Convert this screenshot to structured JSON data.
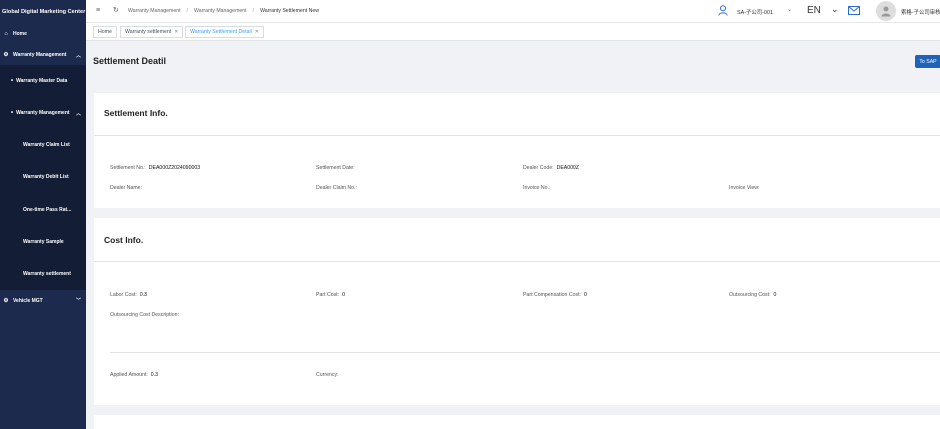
{
  "sidebar": {
    "title": "Global Digital Marketing Center",
    "home": "Home",
    "warranty_management": "Warranty Management",
    "warranty_master_data": "Warranty Master Data",
    "warranty_management_sub": "Warranty Management",
    "items": [
      "Warranty Claim List",
      "Warranty Debit List",
      "One-time Pass Rat...",
      "Warranty Sample",
      "Warranty settlement"
    ],
    "vehicle_mgt": "Vehicle MGT"
  },
  "header": {
    "breadcrumb": [
      "Warranty Management",
      "Warranty Management",
      "Warranty Settlement New"
    ],
    "org": "SA-子公司-001",
    "lang": "EN",
    "user": "索格-子公司审核"
  },
  "tabs": [
    {
      "label": "Home"
    },
    {
      "label": "Warranty settlement"
    },
    {
      "label": "Warranty Settlement Detail"
    }
  ],
  "page": {
    "title": "Settlement Deatil",
    "sap_button": "To SAP"
  },
  "settlement": {
    "title": "Settlement Info.",
    "settlement_no_label": "Settlement No.:",
    "settlement_no": "DEA000Z2024090003",
    "settlement_date_label": "Settlement Date:",
    "settlement_date": "",
    "dealer_code_label": "Dealer Code:",
    "dealer_code": "DEA000Z",
    "dealer_name_label": "Dealer Name:",
    "dealer_name": "",
    "dealer_claim_no_label": "Dealer Claim No.:",
    "dealer_claim_no": "",
    "invoice_no_label": "Invoice No.:",
    "invoice_no": "",
    "invoice_view_label": "Invoice View:"
  },
  "cost": {
    "title": "Cost Info.",
    "labor_cost_label": "Labor Cost:",
    "labor_cost": "0.3",
    "part_cost_label": "Part Cost:",
    "part_cost": "0",
    "part_comp_cost_label": "Part Compensation Cost:",
    "part_comp_cost": "0",
    "outsourcing_cost_label": "Outsourcing Cost:",
    "outsourcing_cost": "0",
    "outsourcing_desc_label": "Outsourcing Cost Description:",
    "applied_amount_label": "Applied Amount:",
    "applied_amount": "0.3",
    "currency_label": "Currency:",
    "currency": ""
  }
}
